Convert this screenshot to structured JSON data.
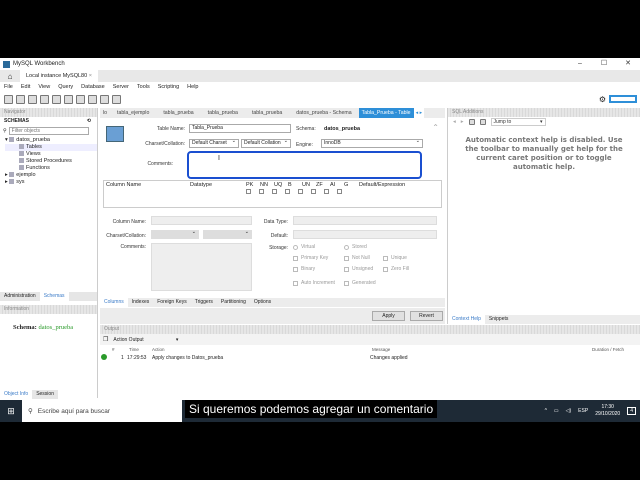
{
  "window": {
    "title": "MySQL Workbench",
    "controls": [
      "–",
      "☐",
      "✕"
    ]
  },
  "connection_tab": {
    "label": "Local instance MySQL80",
    "close": "×"
  },
  "menu": [
    "File",
    "Edit",
    "View",
    "Query",
    "Database",
    "Server",
    "Tools",
    "Scripting",
    "Help"
  ],
  "navigator": {
    "header": "Navigator",
    "schemas_title": "SCHEMAS",
    "filter_placeholder": "Filter objects",
    "tree": [
      {
        "label": "datos_prueba",
        "children": [
          "Tables",
          "Views",
          "Stored Procedures",
          "Functions"
        ]
      },
      {
        "label": "ejemplo"
      },
      {
        "label": "sys"
      }
    ],
    "tabs": [
      "Administration",
      "Schemas"
    ],
    "info_header": "Information",
    "info_label": "Schema:",
    "info_value": "datos_prueba",
    "bottom_tabs": [
      "Object Info",
      "Session"
    ]
  },
  "editor_tabs": [
    "lo",
    "tabla_ejemplo",
    "tabla_prueba",
    "tabla_prueba",
    "tabla_prueba",
    "datos_prueba - Schema",
    "Tabla_Prueba - Table"
  ],
  "table_editor": {
    "table_name_label": "Table Name:",
    "table_name": "Tabla_Prueba",
    "schema_label": "Schema:",
    "schema": "datos_prueba",
    "charset_label": "Charset/Collation:",
    "charset": "Default Charset",
    "collation": "Default Collation",
    "engine_label": "Engine:",
    "engine": "InnoDB",
    "comments_label": "Comments:",
    "comments": "",
    "grid_headers": [
      "Column Name",
      "Datatype",
      "PK",
      "NN",
      "UQ",
      "B",
      "UN",
      "ZF",
      "AI",
      "G",
      "Default/Expression"
    ],
    "detail": {
      "column_name": "Column Name:",
      "charset": "Charset/Collation:",
      "comments": "Comments:",
      "data_type": "Data Type:",
      "default": "Default:",
      "storage": "Storage:",
      "options": [
        "Virtual",
        "Stored",
        "Primary Key",
        "Not Null",
        "Unique",
        "Binary",
        "Unsigned",
        "Zero Fill",
        "Auto Increment",
        "Generated"
      ]
    },
    "bottom_tabs": [
      "Columns",
      "Indexes",
      "Foreign Keys",
      "Triggers",
      "Partitioning",
      "Options"
    ],
    "apply": "Apply",
    "revert": "Revert"
  },
  "sql_additions": {
    "header": "SQL Additions",
    "jump_to": "Jump to",
    "help_text": "Automatic context help is disabled. Use the toolbar to manually get help for the current caret position or to toggle automatic help.",
    "tabs": [
      "Context Help",
      "Snippets"
    ]
  },
  "output": {
    "header": "Output",
    "selector": "Action Output",
    "columns": [
      "#",
      "Time",
      "Action",
      "Message",
      "Duration / Fetch"
    ],
    "rows": [
      {
        "num": "1",
        "time": "17:29:53",
        "action": "Apply changes to Datos_prueba",
        "message": "Changes applied",
        "duration": ""
      }
    ]
  },
  "taskbar": {
    "search_placeholder": "Escribe aquí para buscar",
    "lang": "ESP",
    "time": "17:30",
    "date": "29/10/2020",
    "notifications": "4"
  },
  "subtitle": "Si queremos podemos agregar un comentario",
  "colors": {
    "accent": "#2e8fd8",
    "schema_green": "#2a9a2a",
    "focus": "#1a4fd0"
  }
}
